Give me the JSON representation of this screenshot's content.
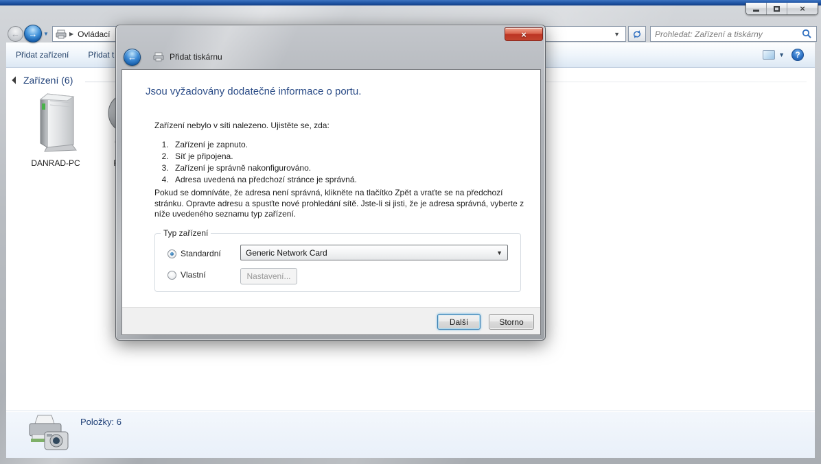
{
  "window": {
    "caption": {
      "close_glyph": "×"
    },
    "nav": {
      "breadcrumb_item": "Ovládací",
      "breadcrumb_sep_glyph": "▶",
      "address_caret_glyph": "▼",
      "search_placeholder": "Prohledat: Zařízení a tiskárny"
    },
    "toolbar": {
      "item_add_device": "Přidat zařízení",
      "item_add_printer_partial": "Přidat t",
      "views_caret_glyph": "▼",
      "help_glyph": "?"
    },
    "content": {
      "group_header": "Zařízení (6)",
      "devices": [
        {
          "label": "DANRAD-PC"
        },
        {
          "label": "FaceC"
        }
      ]
    },
    "statusbar": {
      "items_text": "Položky: 6"
    }
  },
  "dialog": {
    "title": "Přidat tiskárnu",
    "close_glyph": "×",
    "heading": "Jsou vyžadovány dodatečné informace o portu.",
    "intro": "Zařízení nebylo v síti nalezeno. Ujistěte se, zda:",
    "checklist": [
      "Zařízení je zapnuto.",
      "Síť je připojena.",
      "Zařízení je správně nakonfigurováno.",
      "Adresa uvedená na předchozí stránce je správná."
    ],
    "paragraph": "Pokud se domníváte, že adresa není správná, klikněte na tlačítko Zpět a vraťte se na předchozí stránku. Opravte adresu a spusťte nové prohledání sítě. Jste-li si jisti, že je adresa správná, vyberte z níže uvedeného seznamu typ zařízení.",
    "group": {
      "label": "Typ zařízení",
      "radio_standard_label": "Standardní",
      "radio_standard_checked": true,
      "radio_custom_label": "Vlastní",
      "radio_custom_checked": false,
      "combo_value": "Generic Network Card",
      "combo_caret_glyph": "▼",
      "settings_button_label": "Nastavení...",
      "settings_button_disabled": true
    },
    "buttons": {
      "next": "Další",
      "cancel": "Storno"
    }
  },
  "colors": {
    "top_strip_blue": "#1f55a5",
    "heading_blue": "#2b4c87",
    "group_header_blue": "#1e3f77",
    "toolbar_text_blue": "#1e3c64",
    "close_button_red": "#bc3323",
    "default_button_border_blue": "#3c7fb1",
    "glass_grey": "#aeb2b7",
    "details_pane_blue": "#e9f0f9"
  }
}
